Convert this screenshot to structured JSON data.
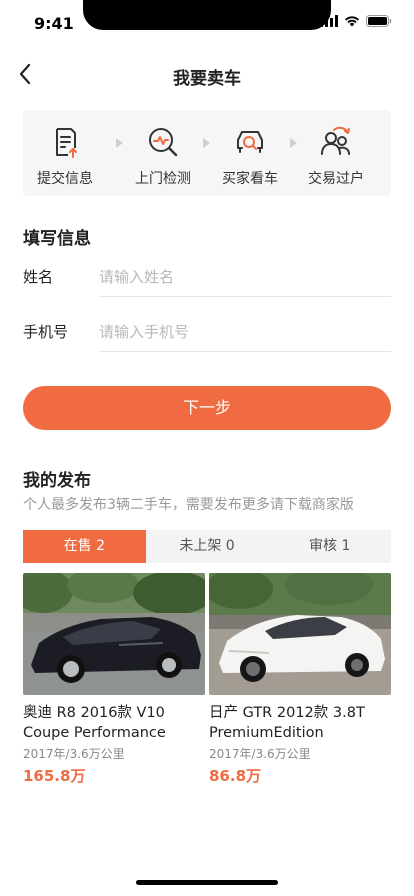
{
  "status_bar": {
    "time": "9:41"
  },
  "nav": {
    "title": "我要卖车"
  },
  "steps": [
    {
      "label": "提交信息",
      "icon": "document-upload-icon"
    },
    {
      "label": "上门检测",
      "icon": "inspect-magnifier-icon"
    },
    {
      "label": "买家看车",
      "icon": "car-search-icon"
    },
    {
      "label": "交易过户",
      "icon": "users-transfer-icon"
    }
  ],
  "form": {
    "title": "填写信息",
    "name_label": "姓名",
    "name_placeholder": "请输入姓名",
    "phone_label": "手机号",
    "phone_placeholder": "请输入手机号"
  },
  "next_button": {
    "label": "下一步"
  },
  "my_listings": {
    "title": "我的发布",
    "subtitle": "个人最多发布3辆二手车，需要发布更多请下载商家版",
    "tabs": [
      {
        "label": "在售 2",
        "active": true
      },
      {
        "label": "未上架 0",
        "active": false
      },
      {
        "label": "审核 1",
        "active": false
      }
    ],
    "cars": [
      {
        "title": "奥迪 R8 2016款 V10 Coupe Performance",
        "meta": "2017年/3.6万公里",
        "price": "165.8万",
        "paint": "black"
      },
      {
        "title": "日产 GTR 2012款 3.8T PremiumEdition",
        "meta": "2017年/3.6万公里",
        "price": "86.8万",
        "paint": "white"
      }
    ]
  },
  "colors": {
    "accent": "#f06b42",
    "step_icon": "#333333",
    "step_icon_accent": "#f06b42"
  }
}
